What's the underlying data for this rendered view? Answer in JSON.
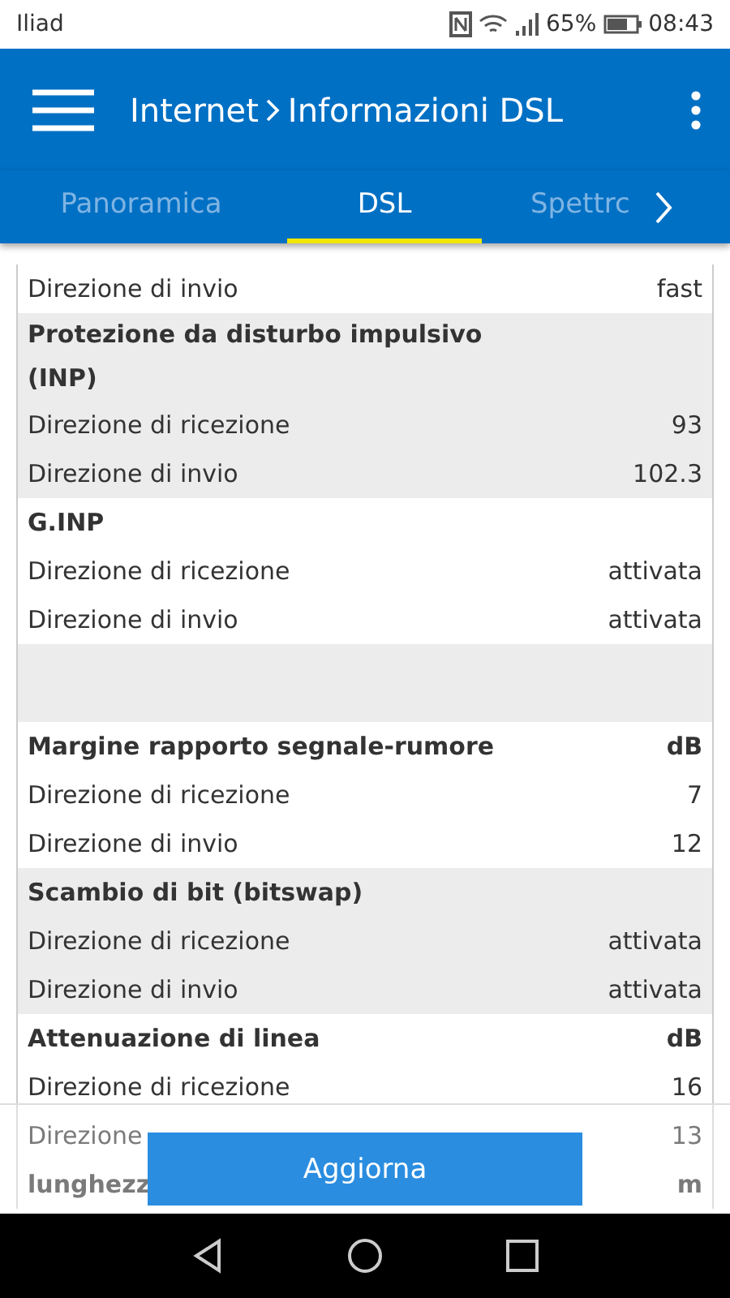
{
  "status_bar": {
    "carrier": "Iliad",
    "battery": "65%",
    "time": "08:43"
  },
  "app_bar": {
    "title": "Internet",
    "subtitle": "Informazioni DSL"
  },
  "tabs": [
    {
      "label": "Panoramica",
      "selected": false
    },
    {
      "label": "DSL",
      "selected": true
    },
    {
      "label": "Spettrc",
      "selected": false
    }
  ],
  "groups": [
    {
      "kind": "rows",
      "shaded": false,
      "rows": [
        {
          "label": "Direzione di invio",
          "value": "fast"
        }
      ]
    },
    {
      "kind": "rows",
      "shaded": true,
      "header": {
        "label": "Protezione da disturbo impulsivo (INP)"
      },
      "rows": [
        {
          "label": "Direzione di ricezione",
          "value": "93"
        },
        {
          "label": "Direzione di invio",
          "value": "102.3"
        }
      ]
    },
    {
      "kind": "rows",
      "shaded": false,
      "header": {
        "label": "G.INP"
      },
      "rows": [
        {
          "label": "Direzione di ricezione",
          "value": "attivata"
        },
        {
          "label": "Direzione di invio",
          "value": "attivata"
        }
      ]
    },
    {
      "kind": "spacer",
      "shaded": true
    },
    {
      "kind": "rows",
      "shaded": false,
      "header": {
        "label": "Margine rapporto segnale-rumore",
        "unit": "dB"
      },
      "rows": [
        {
          "label": "Direzione di ricezione",
          "value": "7"
        },
        {
          "label": "Direzione di invio",
          "value": "12"
        }
      ]
    },
    {
      "kind": "rows",
      "shaded": true,
      "header": {
        "label": "Scambio di bit (bitswap)"
      },
      "rows": [
        {
          "label": "Direzione di ricezione",
          "value": "attivata"
        },
        {
          "label": "Direzione di invio",
          "value": "attivata"
        }
      ]
    },
    {
      "kind": "rows",
      "shaded": false,
      "header": {
        "label": "Attenuazione di linea",
        "unit": "dB"
      },
      "rows": [
        {
          "label": "Direzione di ricezione",
          "value": "16"
        }
      ]
    }
  ],
  "faded_rows": [
    {
      "label": "Direzione",
      "value": "13",
      "bold": false
    },
    {
      "label": "lunghezz",
      "value": "m",
      "bold": true
    }
  ],
  "button": "Aggiorna"
}
